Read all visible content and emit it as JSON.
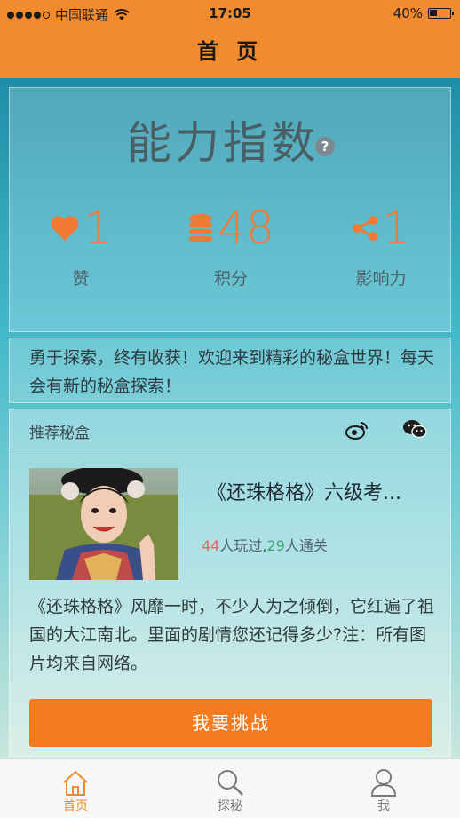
{
  "status_bar": {
    "carrier": "中国联通",
    "time": "17:05",
    "battery_percent": "40%",
    "battery_level": 0.4
  },
  "nav": {
    "title": "首 页"
  },
  "ability": {
    "title": "能力指数",
    "help_glyph": "?",
    "stats": [
      {
        "icon": "heart-icon",
        "value": "1",
        "label": "赞"
      },
      {
        "icon": "coins-icon",
        "value": "48",
        "label": "积分"
      },
      {
        "icon": "share-icon",
        "value": "1",
        "label": "影响力"
      }
    ]
  },
  "welcome": {
    "text": "勇于探索，终有收获！欢迎来到精彩的秘盒世界！每天会有新的秘盒探索！"
  },
  "recommend": {
    "label": "推荐秘盒",
    "quiz_title": "《还珠格格》六级考...",
    "played_count": "44",
    "played_text": "人玩过,",
    "passed_count": "29",
    "passed_text": "人通关",
    "description": "《还珠格格》风靡一时，不少人为之倾倒，它红遍了祖国的大江南北。里面的剧情您还记得多少?注：所有图片均来自网络。",
    "button_label": "我要挑战"
  },
  "tabs": [
    {
      "label": "首页",
      "icon": "home-icon",
      "active": true
    },
    {
      "label": "探秘",
      "icon": "search-icon",
      "active": false
    },
    {
      "label": "我",
      "icon": "user-icon",
      "active": false
    }
  ],
  "colors": {
    "accent": "#f28a2e",
    "button": "#f47b20",
    "stat": "#f07a35"
  }
}
